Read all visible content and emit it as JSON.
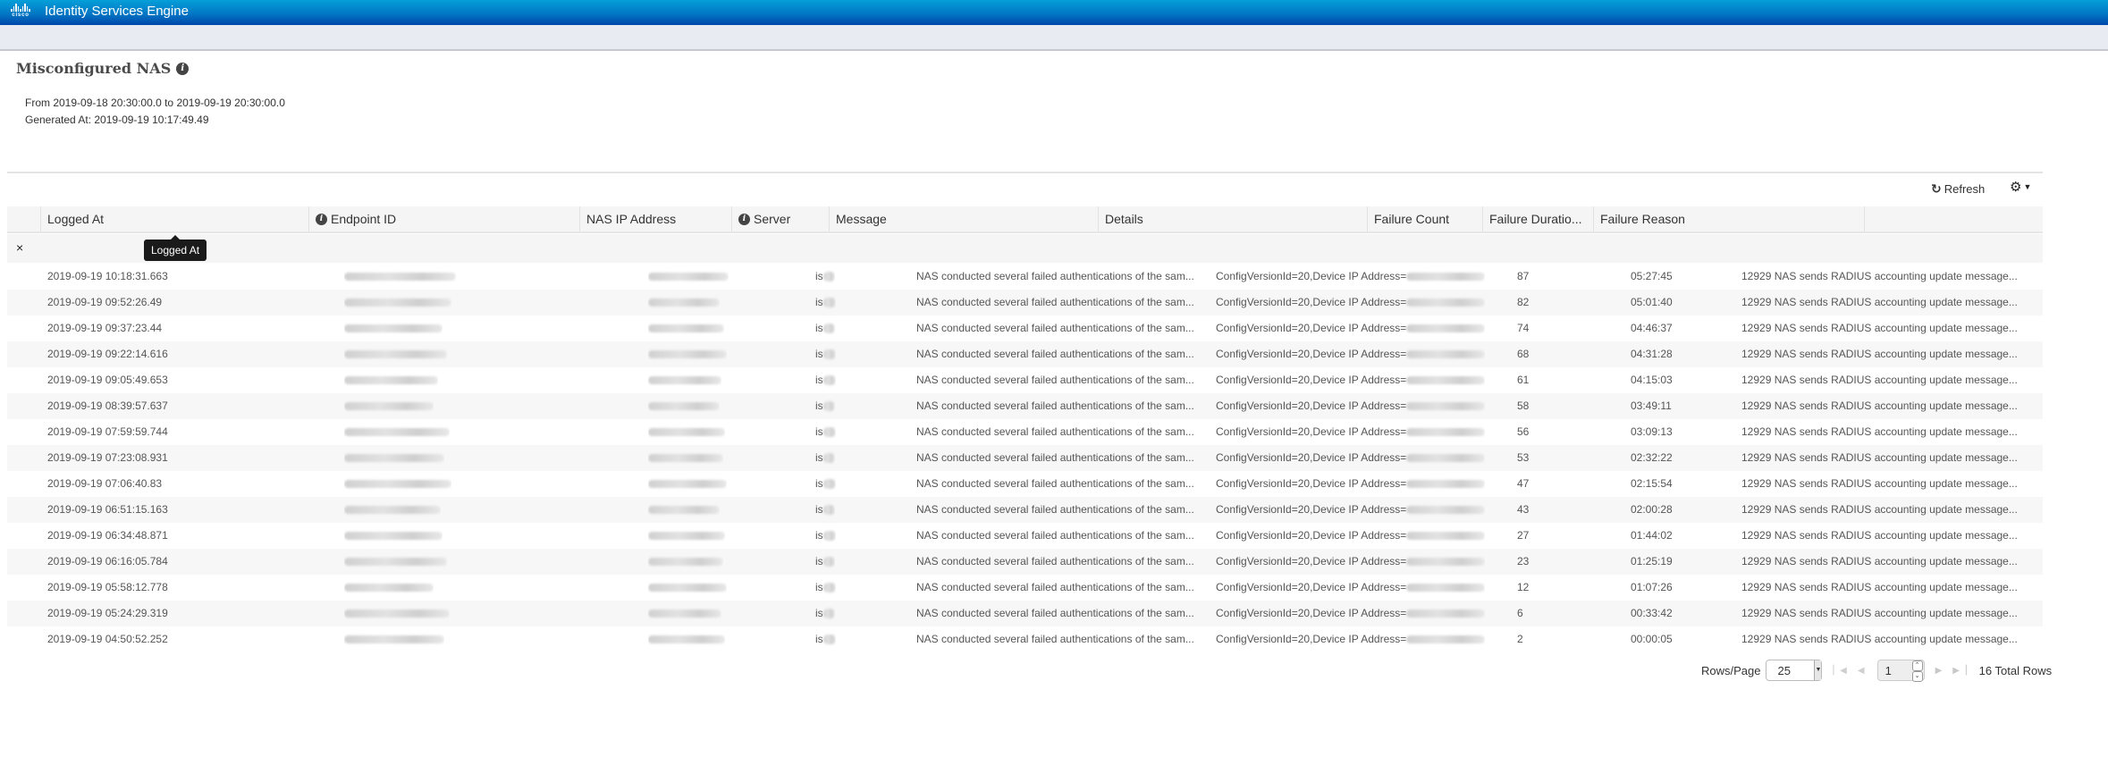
{
  "app": {
    "brand": "cisco",
    "title": "Identity Services Engine",
    "accent_color": "#0277c4"
  },
  "report": {
    "title": "Misconfigured NAS",
    "info_icon": "info-icon",
    "from_range": "From 2019-09-18 20:30:00.0 to 2019-09-19 20:30:00.0",
    "generated_at": "Generated At: 2019-09-19 10:17:49.49"
  },
  "toolbar": {
    "refresh_label": "Refresh",
    "refresh_icon": "refresh-icon",
    "settings_icon": "gear-icon"
  },
  "table": {
    "columns": [
      {
        "label": "Logged At",
        "info": false
      },
      {
        "label": "Endpoint ID",
        "info": true
      },
      {
        "label": "NAS IP Address",
        "info": false
      },
      {
        "label": "Server",
        "info": true
      },
      {
        "label": "Message",
        "info": false
      },
      {
        "label": "Details",
        "info": false
      },
      {
        "label": "Failure Count",
        "info": false
      },
      {
        "label": "Failure Duratio...",
        "info": false
      },
      {
        "label": "Failure Reason",
        "info": false
      },
      {
        "label": "",
        "info": false
      }
    ],
    "filter_clear": "×",
    "tooltip": "Logged At",
    "rows": [
      {
        "logged_at": "2019-09-19 10:18:31.663",
        "server": "is",
        "message": "NAS conducted several failed authentications of the sam...",
        "details": "ConfigVersionId=20,Device IP Address=",
        "failure_count": "87",
        "failure_duration": "05:27:45",
        "failure_reason": "12929 NAS sends RADIUS accounting update message..."
      },
      {
        "logged_at": "2019-09-19 09:52:26.49",
        "server": "is",
        "message": "NAS conducted several failed authentications of the sam...",
        "details": "ConfigVersionId=20,Device IP Address=",
        "failure_count": "82",
        "failure_duration": "05:01:40",
        "failure_reason": "12929 NAS sends RADIUS accounting update message..."
      },
      {
        "logged_at": "2019-09-19 09:37:23.44",
        "server": "is",
        "message": "NAS conducted several failed authentications of the sam...",
        "details": "ConfigVersionId=20,Device IP Address=",
        "failure_count": "74",
        "failure_duration": "04:46:37",
        "failure_reason": "12929 NAS sends RADIUS accounting update message..."
      },
      {
        "logged_at": "2019-09-19 09:22:14.616",
        "server": "is",
        "message": "NAS conducted several failed authentications of the sam...",
        "details": "ConfigVersionId=20,Device IP Address=",
        "failure_count": "68",
        "failure_duration": "04:31:28",
        "failure_reason": "12929 NAS sends RADIUS accounting update message..."
      },
      {
        "logged_at": "2019-09-19 09:05:49.653",
        "server": "is",
        "message": "NAS conducted several failed authentications of the sam...",
        "details": "ConfigVersionId=20,Device IP Address=",
        "failure_count": "61",
        "failure_duration": "04:15:03",
        "failure_reason": "12929 NAS sends RADIUS accounting update message..."
      },
      {
        "logged_at": "2019-09-19 08:39:57.637",
        "server": "is",
        "message": "NAS conducted several failed authentications of the sam...",
        "details": "ConfigVersionId=20,Device IP Address=",
        "failure_count": "58",
        "failure_duration": "03:49:11",
        "failure_reason": "12929 NAS sends RADIUS accounting update message..."
      },
      {
        "logged_at": "2019-09-19 07:59:59.744",
        "server": "is",
        "message": "NAS conducted several failed authentications of the sam...",
        "details": "ConfigVersionId=20,Device IP Address=",
        "failure_count": "56",
        "failure_duration": "03:09:13",
        "failure_reason": "12929 NAS sends RADIUS accounting update message..."
      },
      {
        "logged_at": "2019-09-19 07:23:08.931",
        "server": "is",
        "message": "NAS conducted several failed authentications of the sam...",
        "details": "ConfigVersionId=20,Device IP Address=",
        "failure_count": "53",
        "failure_duration": "02:32:22",
        "failure_reason": "12929 NAS sends RADIUS accounting update message..."
      },
      {
        "logged_at": "2019-09-19 07:06:40.83",
        "server": "is",
        "message": "NAS conducted several failed authentications of the sam...",
        "details": "ConfigVersionId=20,Device IP Address=",
        "failure_count": "47",
        "failure_duration": "02:15:54",
        "failure_reason": "12929 NAS sends RADIUS accounting update message..."
      },
      {
        "logged_at": "2019-09-19 06:51:15.163",
        "server": "is",
        "message": "NAS conducted several failed authentications of the sam...",
        "details": "ConfigVersionId=20,Device IP Address=",
        "failure_count": "43",
        "failure_duration": "02:00:28",
        "failure_reason": "12929 NAS sends RADIUS accounting update message..."
      },
      {
        "logged_at": "2019-09-19 06:34:48.871",
        "server": "is",
        "message": "NAS conducted several failed authentications of the sam...",
        "details": "ConfigVersionId=20,Device IP Address=",
        "failure_count": "27",
        "failure_duration": "01:44:02",
        "failure_reason": "12929 NAS sends RADIUS accounting update message..."
      },
      {
        "logged_at": "2019-09-19 06:16:05.784",
        "server": "is",
        "message": "NAS conducted several failed authentications of the sam...",
        "details": "ConfigVersionId=20,Device IP Address=",
        "failure_count": "23",
        "failure_duration": "01:25:19",
        "failure_reason": "12929 NAS sends RADIUS accounting update message..."
      },
      {
        "logged_at": "2019-09-19 05:58:12.778",
        "server": "is",
        "message": "NAS conducted several failed authentications of the sam...",
        "details": "ConfigVersionId=20,Device IP Address=",
        "failure_count": "12",
        "failure_duration": "01:07:26",
        "failure_reason": "12929 NAS sends RADIUS accounting update message..."
      },
      {
        "logged_at": "2019-09-19 05:24:29.319",
        "server": "is",
        "message": "NAS conducted several failed authentications of the sam...",
        "details": "ConfigVersionId=20,Device IP Address=",
        "failure_count": "6",
        "failure_duration": "00:33:42",
        "failure_reason": "12929 NAS sends RADIUS accounting update message..."
      },
      {
        "logged_at": "2019-09-19 04:50:52.252",
        "server": "is",
        "message": "NAS conducted several failed authentications of the sam...",
        "details": "ConfigVersionId=20,Device IP Address=",
        "failure_count": "2",
        "failure_duration": "00:00:05",
        "failure_reason": "12929 NAS sends RADIUS accounting update message..."
      }
    ]
  },
  "pagination": {
    "rows_per_page_label": "Rows/Page",
    "rows_per_page": "25",
    "current_page": "1",
    "total_rows": "16 Total Rows"
  }
}
